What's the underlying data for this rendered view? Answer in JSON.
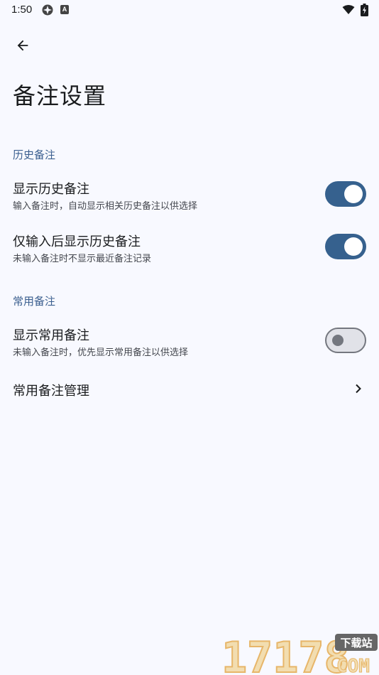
{
  "status_bar": {
    "time": "1:50",
    "app_icon_letter": "A"
  },
  "header": {
    "title": "备注设置"
  },
  "sections": [
    {
      "header": "历史备注",
      "items": [
        {
          "title": "显示历史备注",
          "summary": "输入备注时，自动显示相关历史备注以供选择",
          "switch_on": true
        },
        {
          "title": "仅输入后显示历史备注",
          "summary": "未输入备注时不显示最近备注记录",
          "switch_on": true
        }
      ]
    },
    {
      "header": "常用备注",
      "items": [
        {
          "title": "显示常用备注",
          "summary": "未输入备注时，优先显示常用备注以供选择",
          "switch_on": false
        },
        {
          "title": "常用备注管理"
        }
      ]
    }
  ],
  "watermark": {
    "number": "17178",
    "badge": "下载站",
    "domain": "COM"
  },
  "colors": {
    "background": "#f8f9ff",
    "accent": "#36618e",
    "section_header": "#3b5f8f",
    "switch_off_track": "#e1e2e8",
    "switch_off_outline": "#74777f"
  },
  "icons": {
    "back": "arrow-left-icon",
    "chevron": "chevron-right-icon",
    "wifi": "wifi-icon",
    "battery": "battery-icon"
  }
}
